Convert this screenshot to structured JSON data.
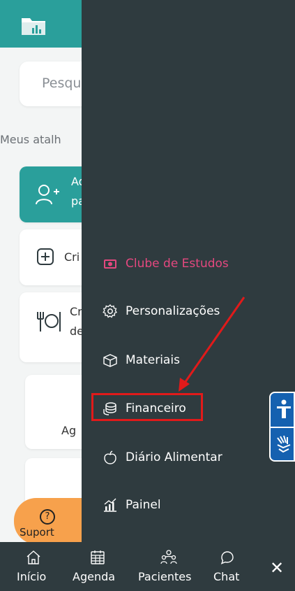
{
  "background": {
    "search_placeholder": "Pesqu",
    "shortcuts_label": "Meus atalh",
    "cards": {
      "add_line1": "Ad",
      "add_line2": "pa",
      "create": "Cri",
      "cardapio_line1": "Cr",
      "cardapio_line2": "de",
      "agenda": "Ag"
    },
    "support_label": "Suport",
    "support_icon": "question-icon",
    "logo_icon": "folder-chart-icon",
    "header_color": "#2a9f9b",
    "support_color": "#f7a14c"
  },
  "menu": {
    "background_color": "#2f3b3f",
    "items": [
      {
        "label": "Clube de Estudos",
        "icon": "camera-icon",
        "color": "#e4487f"
      },
      {
        "label": "Personalizações",
        "icon": "gear-icon"
      },
      {
        "label": "Materiais",
        "icon": "box-icon"
      },
      {
        "label": "Financeiro",
        "icon": "coins-icon",
        "highlighted": true
      },
      {
        "label": "Diário Alimentar",
        "icon": "apple-icon"
      },
      {
        "label": "Painel",
        "icon": "chart-icon"
      }
    ],
    "highlight_color": "#e11a1a"
  },
  "accessibility": {
    "icons": [
      "accessibility-person-icon",
      "sign-language-icon"
    ],
    "color": "#1561b0"
  },
  "bottom_nav": {
    "items": [
      {
        "label": "Início",
        "icon": "home-icon"
      },
      {
        "label": "Agenda",
        "icon": "calendar-icon"
      },
      {
        "label": "Pacientes",
        "icon": "people-icon"
      },
      {
        "label": "Chat",
        "icon": "chat-icon"
      }
    ],
    "close_label": "✕"
  }
}
